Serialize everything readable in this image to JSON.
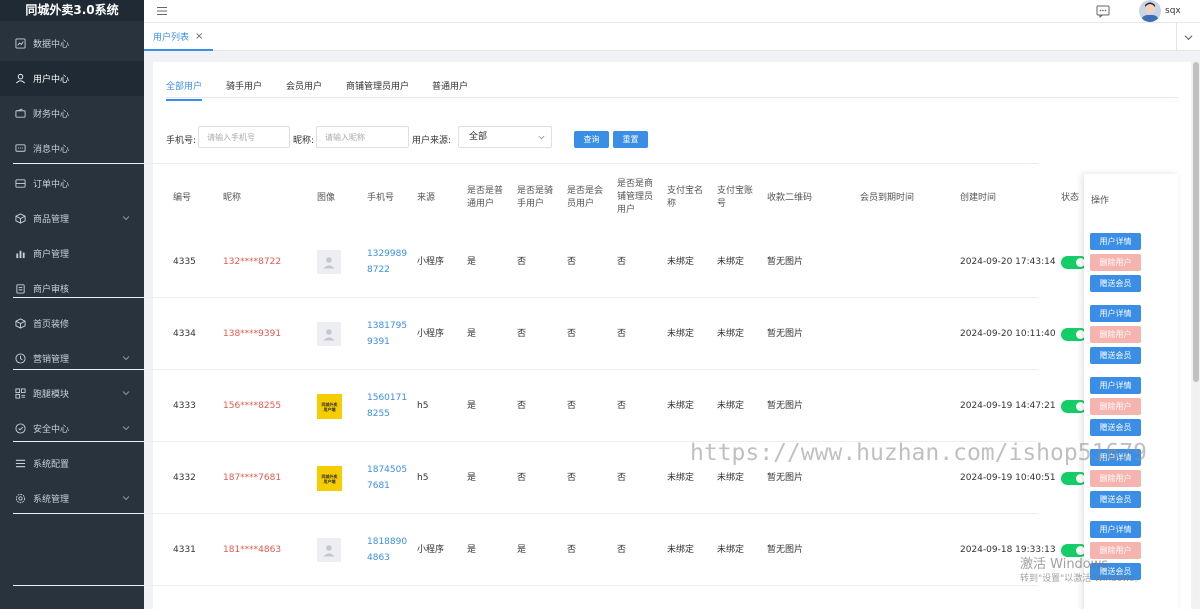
{
  "app": {
    "title": "同城外卖3.0系统"
  },
  "sidebar": {
    "items": [
      {
        "label": "数据中心",
        "icon": "chart-icon",
        "arrow": false
      },
      {
        "label": "用户中心",
        "icon": "user-icon",
        "arrow": false,
        "active": true
      },
      {
        "label": "财务中心",
        "icon": "wallet-icon",
        "arrow": false
      },
      {
        "label": "消息中心",
        "icon": "message-icon",
        "arrow": false
      },
      {
        "label": "订单中心",
        "icon": "order-icon",
        "arrow": false
      },
      {
        "label": "商品管理",
        "icon": "box-icon",
        "arrow": true
      },
      {
        "label": "商户管理",
        "icon": "bar-chart-icon",
        "arrow": false
      },
      {
        "label": "商户审核",
        "icon": "clipboard-icon",
        "arrow": false
      },
      {
        "label": "首页装修",
        "icon": "cube-icon",
        "arrow": false
      },
      {
        "label": "营销管理",
        "icon": "clock-icon",
        "arrow": true
      },
      {
        "label": "跑腿模块",
        "icon": "grid-icon",
        "arrow": true
      },
      {
        "label": "安全中心",
        "icon": "shield-icon",
        "arrow": true
      },
      {
        "label": "系统配置",
        "icon": "list-icon",
        "arrow": false
      },
      {
        "label": "系统管理",
        "icon": "gear-icon",
        "arrow": true
      }
    ]
  },
  "header": {
    "username": "sqx"
  },
  "tabs": [
    {
      "label": "用户列表",
      "close": "×"
    }
  ],
  "subtabs": [
    "全部用户",
    "骑手用户",
    "会员用户",
    "商铺管理员用户",
    "普通用户"
  ],
  "filters": {
    "phone_label": "手机号:",
    "phone_placeholder": "请输入手机号",
    "nick_label": "昵称:",
    "nick_placeholder": "请输入昵称",
    "source_label": "用户来源:",
    "source_value": "全部",
    "search_btn": "查询",
    "reset_btn": "重置"
  },
  "table": {
    "headers": {
      "id": "编号",
      "nick": "昵称",
      "avatar": "图像",
      "phone": "手机号",
      "source": "来源",
      "is_normal": [
        "是否是普",
        "通用户"
      ],
      "is_rider": [
        "是否是骑",
        "手用户"
      ],
      "is_member": [
        "是否是会",
        "员用户"
      ],
      "is_shop_admin": [
        "是否是商",
        "铺管理员",
        "用户"
      ],
      "alipay_name": [
        "支付宝名",
        "称"
      ],
      "alipay_acct": [
        "支付宝账",
        "号"
      ],
      "qrcode": "收款二维码",
      "member_expire": "会员到期时间",
      "created": "创建时间",
      "status": "状态",
      "ops": "操作"
    },
    "logo_text": [
      "同城外卖",
      "用户端"
    ],
    "rows": [
      {
        "id": "4335",
        "nick": "132****8722",
        "avatar": "placeholder",
        "phone": [
          "1329989",
          "8722"
        ],
        "source": "小程序",
        "is_normal": "是",
        "is_rider": "否",
        "is_member": "否",
        "is_shop_admin": "否",
        "alipay_name": "未绑定",
        "alipay_acct": "未绑定",
        "qrcode": "暂无图片",
        "created": "2024-09-20 17:43:14"
      },
      {
        "id": "4334",
        "nick": "138****9391",
        "avatar": "placeholder",
        "phone": [
          "1381795",
          "9391"
        ],
        "source": "小程序",
        "is_normal": "是",
        "is_rider": "否",
        "is_member": "否",
        "is_shop_admin": "否",
        "alipay_name": "未绑定",
        "alipay_acct": "未绑定",
        "qrcode": "暂无图片",
        "created": "2024-09-20 10:11:40"
      },
      {
        "id": "4333",
        "nick": "156****8255",
        "avatar": "logo",
        "phone": [
          "1560171",
          "8255"
        ],
        "source": "h5",
        "is_normal": "是",
        "is_rider": "否",
        "is_member": "否",
        "is_shop_admin": "否",
        "alipay_name": "未绑定",
        "alipay_acct": "未绑定",
        "qrcode": "暂无图片",
        "created": "2024-09-19 14:47:21"
      },
      {
        "id": "4332",
        "nick": "187****7681",
        "avatar": "logo",
        "phone": [
          "1874505",
          "7681"
        ],
        "source": "h5",
        "is_normal": "是",
        "is_rider": "否",
        "is_member": "否",
        "is_shop_admin": "否",
        "alipay_name": "未绑定",
        "alipay_acct": "未绑定",
        "qrcode": "暂无图片",
        "created": "2024-09-19 10:40:51"
      },
      {
        "id": "4331",
        "nick": "181****4863",
        "avatar": "placeholder",
        "phone": [
          "1818890",
          "4863"
        ],
        "source": "小程序",
        "is_normal": "是",
        "is_rider": "是",
        "is_member": "否",
        "is_shop_admin": "否",
        "alipay_name": "未绑定",
        "alipay_acct": "未绑定",
        "qrcode": "暂无图片",
        "created": "2024-09-18 19:33:13"
      }
    ],
    "op_labels": {
      "detail": "用户详情",
      "delete": "删除用户",
      "gift": "赠送会员"
    }
  },
  "overlay": {
    "watermark": "https://www.huzhan.com/ishop51679",
    "activate_title": "激活 Windows",
    "activate_hint": "转到\"设置\"以激活 Windows。"
  },
  "colors": {
    "sidebar_bg": "#28333e",
    "accent": "#3a8ee6",
    "nick": "#e05a4f",
    "toggle_on": "#13ce66",
    "delete_btn": "#f5b4b0"
  }
}
